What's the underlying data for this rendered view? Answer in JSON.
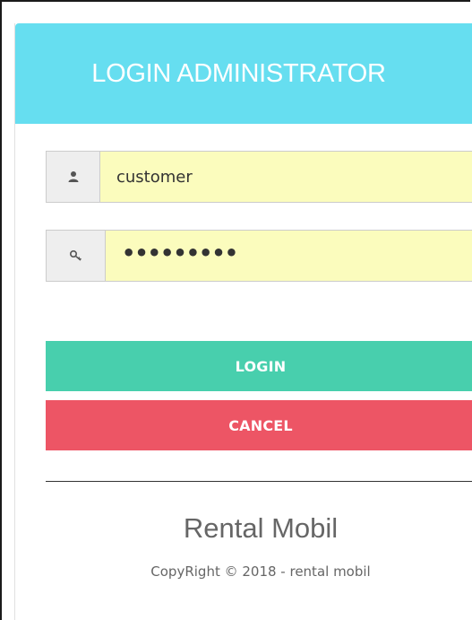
{
  "header": {
    "title": "LOGIN ADMINISTRATOR"
  },
  "form": {
    "username": {
      "icon": "user-icon",
      "value": "customer"
    },
    "password": {
      "icon": "key-icon",
      "value": "•••••••••"
    }
  },
  "buttons": {
    "login_label": "LOGIN",
    "cancel_label": "CANCEL"
  },
  "footer": {
    "brand": "Rental Mobil",
    "copyright": "CopyRight © 2018 - rental mobil"
  },
  "colors": {
    "header": "#66def0",
    "login": "#48cfad",
    "cancel": "#ed5565",
    "input_bg": "#fbfcbd"
  }
}
